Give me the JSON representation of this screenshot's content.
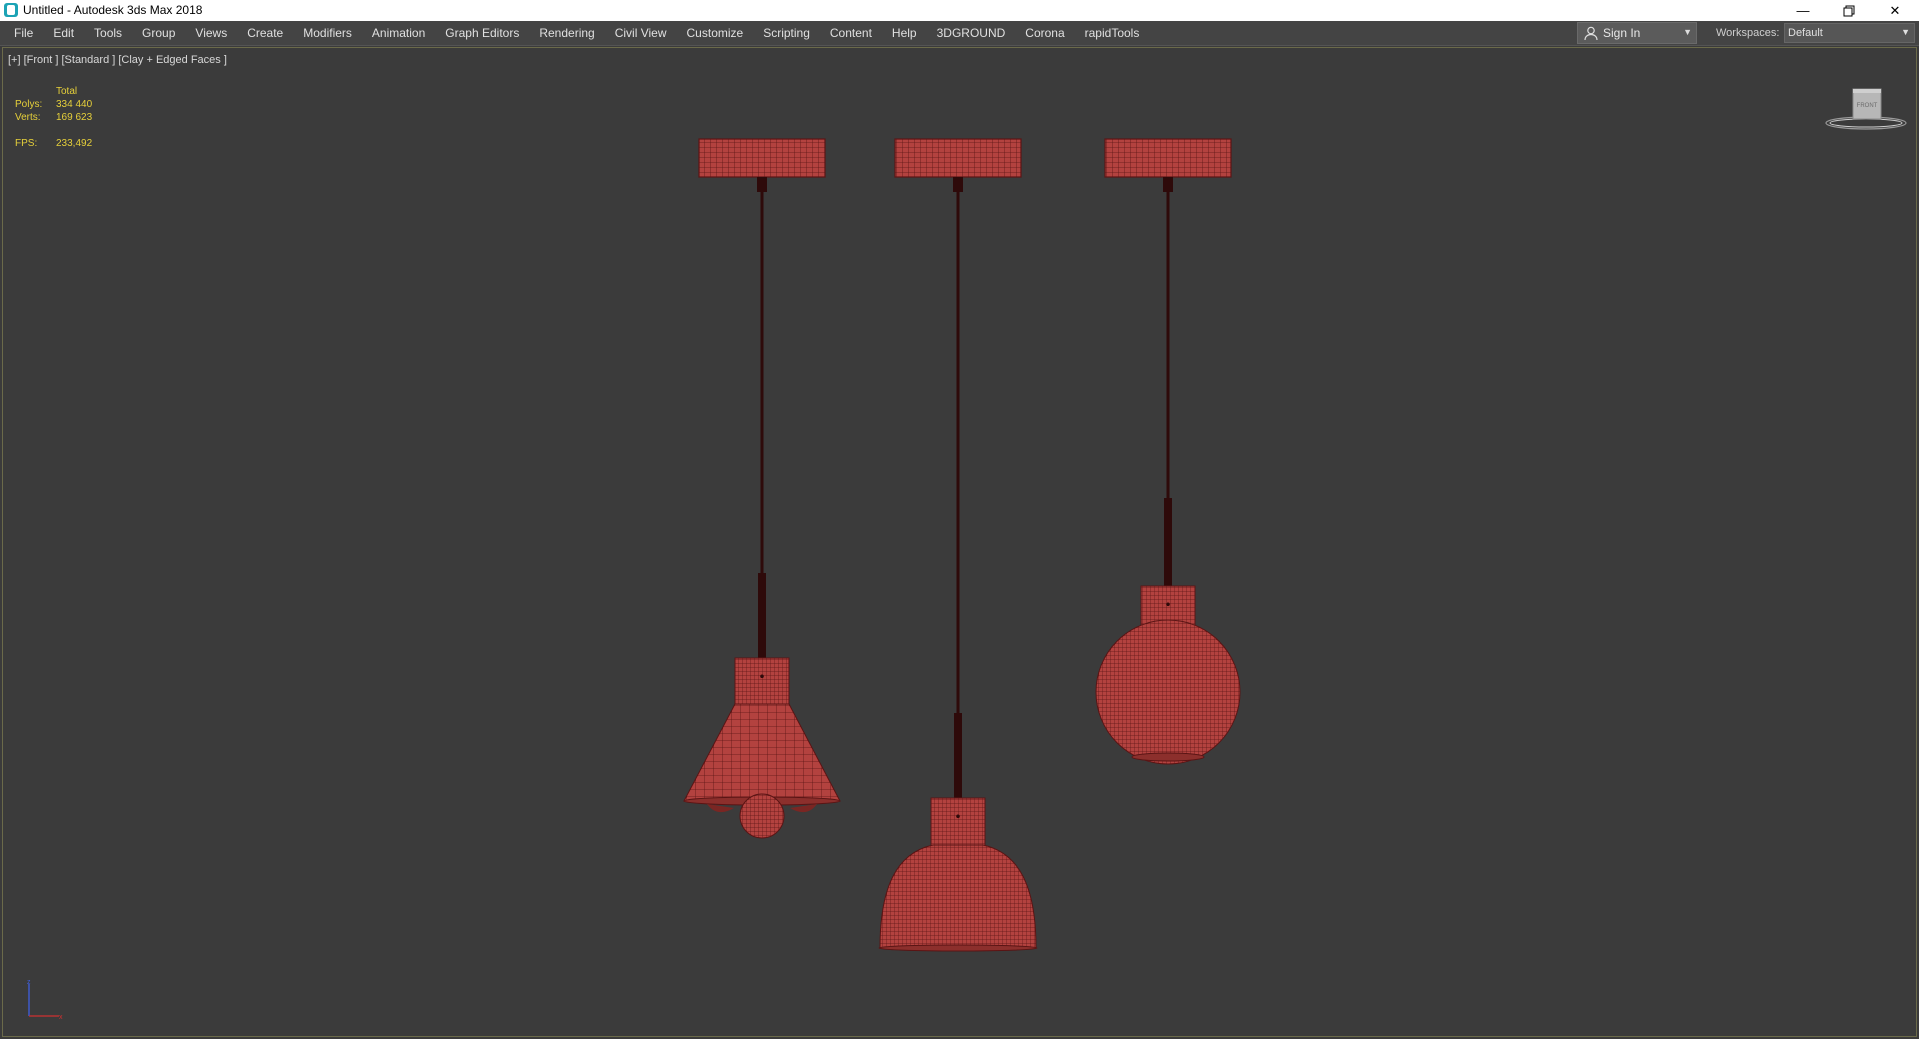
{
  "window": {
    "title": "Untitled - Autodesk 3ds Max 2018",
    "app_icon": "3ds-max-icon",
    "controls": [
      "minimize-icon",
      "restore-icon",
      "close-icon"
    ]
  },
  "menubar": {
    "items": [
      "File",
      "Edit",
      "Tools",
      "Group",
      "Views",
      "Create",
      "Modifiers",
      "Animation",
      "Graph Editors",
      "Rendering",
      "Civil View",
      "Customize",
      "Scripting",
      "Content",
      "Help",
      "3DGROUND",
      "Corona",
      "rapidTools"
    ],
    "sign_in": {
      "label": "Sign In",
      "icon": "user-icon"
    },
    "workspaces": {
      "label": "Workspaces:",
      "value": "Default"
    }
  },
  "viewport": {
    "label": "[+] [Front ] [Standard ] [Clay + Edged Faces ]",
    "stats": {
      "header": "Total",
      "polys_label": "Polys:",
      "polys_value": "334 440",
      "verts_label": "Verts:",
      "verts_value": "169 623",
      "fps_label": "FPS:",
      "fps_value": "233,492"
    },
    "viewcube_label": "FRONT",
    "colors": {
      "background": "#3b3b3b",
      "mesh_fill": "#b3423f",
      "mesh_wire": "#5a1414",
      "cord": "#2e0a0a",
      "stats_text": "#e6d03a"
    },
    "objects": [
      "cone-pendant-lamp",
      "dome-pendant-lamp",
      "sphere-pendant-lamp"
    ]
  }
}
